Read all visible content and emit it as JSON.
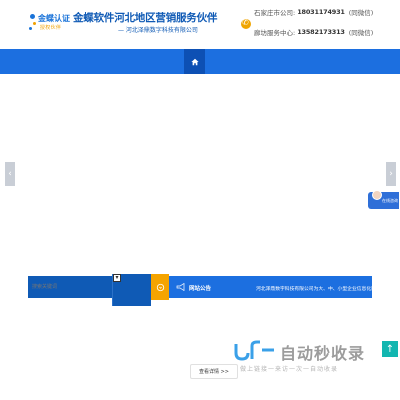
{
  "header": {
    "badge_line1": "金蝶认证",
    "badge_line2": "授权伙伴",
    "brand_title": "金蝶软件河北地区营销服务伙伴",
    "brand_sub": "— 河北泽鼎数字科技有限公司",
    "contacts": [
      {
        "label": "石家庄市公司:",
        "number": "18031174931",
        "note": "(同微信)"
      },
      {
        "label": "廊坊服务中心:",
        "number": "13582173313",
        "note": "(同微信)"
      }
    ]
  },
  "nav": {
    "home_icon": "home-icon"
  },
  "banner": {
    "prev": "‹",
    "next": "›"
  },
  "service": {
    "label": "在线咨询"
  },
  "search": {
    "placeholder": "搜索关键词",
    "select_caret": "▾"
  },
  "notice": {
    "title": "网站公告",
    "text": "河北泽鼎数字科技有限公司为大、中、小型企业信息化服"
  },
  "watermark": {
    "title": "自动秒收录",
    "sub": "做上链接一来访一次一自动收录"
  },
  "more_button": "查看详情 >>",
  "to_top": "↑",
  "colors": {
    "brand_blue": "#1c6fe0",
    "dark_blue": "#0f5ab5",
    "accent_orange": "#f5a400",
    "teal": "#12b6b0"
  }
}
